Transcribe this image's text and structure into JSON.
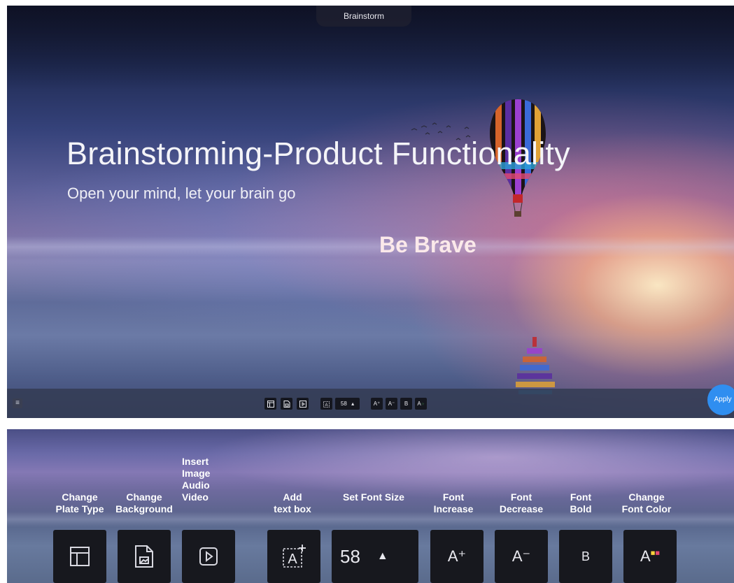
{
  "app": {
    "title": "Brainstorm"
  },
  "slide": {
    "heading": "Brainstorming-Product Functionality",
    "subheading": "Open your mind, let your brain go",
    "callout": "Be Brave"
  },
  "toolbar": {
    "menu_icon": "hamburger-icon",
    "font_size": "58",
    "font_increase_glyph": "A⁺",
    "font_decrease_glyph": "A⁻",
    "font_bold_glyph": "B",
    "font_color_glyph": "A",
    "apply_label": "Apply"
  },
  "legend": {
    "change_plate_type": "Change\nPlate Type",
    "change_background": "Change\nBackground",
    "insert_media": "Insert\nImage\nAudio\nVideo",
    "add_text_box": "Add\ntext box",
    "set_font_size": "Set Font Size",
    "font_increase": "Font\nIncrease",
    "font_decrease": "Font\nDecrease",
    "font_bold": "Font\nBold",
    "change_font_color": "Change\nFont Color"
  },
  "colors": {
    "apply_button": "#2f8ef0",
    "toolbar_button": "#17181e"
  }
}
